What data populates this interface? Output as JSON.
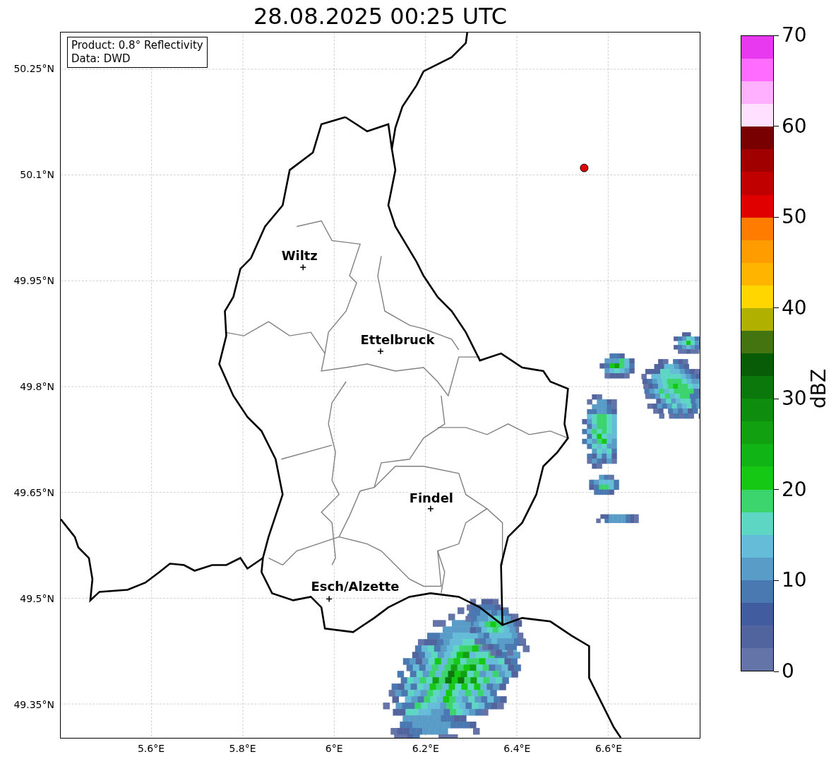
{
  "title": "28.08.2025 00:25 UTC",
  "info_box": [
    "Product: 0.8° Reflectivity",
    "Data: DWD"
  ],
  "lat_ticks": [
    "50.25°N",
    "50.1°N",
    "49.95°N",
    "49.8°N",
    "49.65°N",
    "49.5°N",
    "49.35°N"
  ],
  "lon_ticks": [
    "5.6°E",
    "5.8°E",
    "6°E",
    "6.2°E",
    "6.4°E",
    "6.6°E"
  ],
  "cities": [
    {
      "name": "Wiltz"
    },
    {
      "name": "Ettelbruck"
    },
    {
      "name": "Findel"
    },
    {
      "name": "Esch/Alzette"
    }
  ],
  "colorbar": {
    "label": "dBZ",
    "ticks": [
      "70",
      "60",
      "50",
      "40",
      "30",
      "20",
      "10",
      "0"
    ],
    "levels": [
      {
        "color": "#e838f0"
      },
      {
        "color": "#ff6cff"
      },
      {
        "color": "#ffb0ff"
      },
      {
        "color": "#ffe0ff"
      },
      {
        "color": "#780000"
      },
      {
        "color": "#a00000"
      },
      {
        "color": "#c00000"
      },
      {
        "color": "#e00000"
      },
      {
        "color": "#ff7c00"
      },
      {
        "color": "#ff9c00"
      },
      {
        "color": "#ffb400"
      },
      {
        "color": "#ffd600"
      },
      {
        "color": "#b0b000"
      },
      {
        "color": "#447410"
      },
      {
        "color": "#085c08"
      },
      {
        "color": "#0a780a"
      },
      {
        "color": "#0e8c0e"
      },
      {
        "color": "#10a010"
      },
      {
        "color": "#10b414"
      },
      {
        "color": "#14c814"
      },
      {
        "color": "#3cd46c"
      },
      {
        "color": "#5ed6c4"
      },
      {
        "color": "#64bcd8"
      },
      {
        "color": "#5a9cc8"
      },
      {
        "color": "#4a78b0"
      },
      {
        "color": "#425ca0"
      },
      {
        "color": "#52649e"
      },
      {
        "color": "#6474a8"
      }
    ]
  }
}
